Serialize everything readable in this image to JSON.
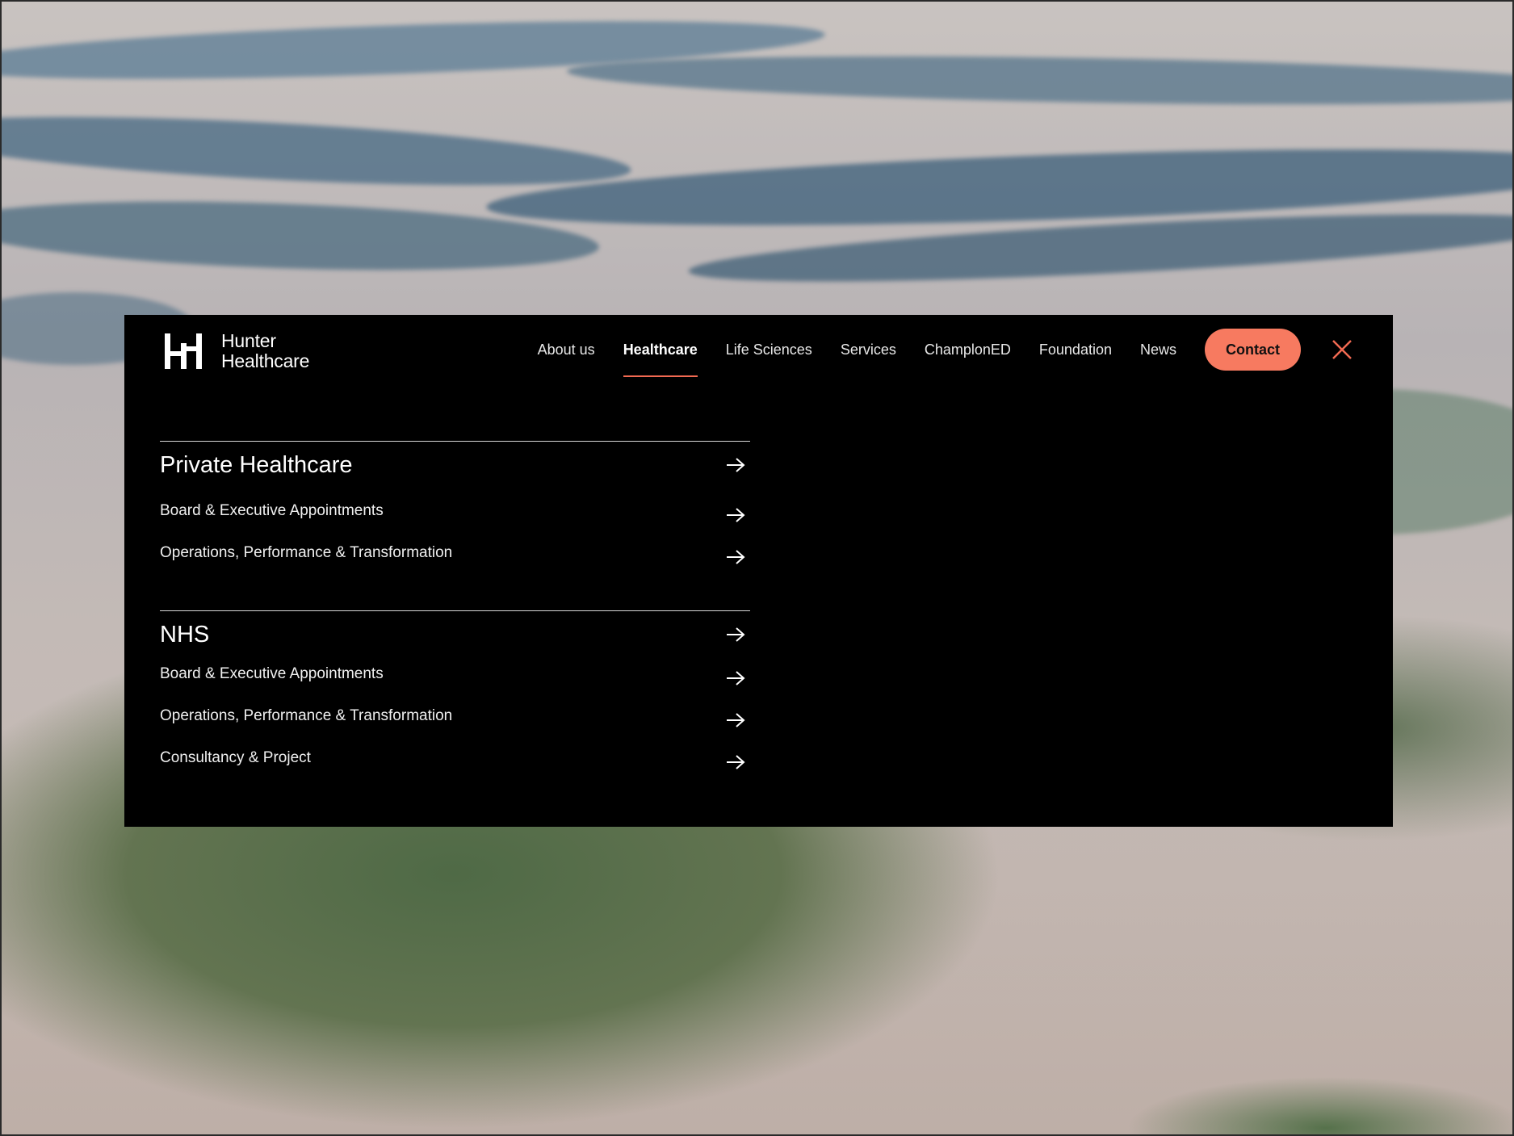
{
  "brand": {
    "name_line1": "Hunter",
    "name_line2": "Healthcare"
  },
  "nav": {
    "items": [
      {
        "label": "About us",
        "active": false
      },
      {
        "label": "Healthcare",
        "active": true
      },
      {
        "label": "Life Sciences",
        "active": false
      },
      {
        "label": "Services",
        "active": false
      },
      {
        "label": "ChamplonED",
        "active": false
      },
      {
        "label": "Foundation",
        "active": false
      },
      {
        "label": "News",
        "active": false
      }
    ],
    "contact_label": "Contact",
    "close_icon": "close-icon"
  },
  "sections": [
    {
      "title": "Private Healthcare",
      "items": [
        "Board & Executive Appointments",
        "Operations, Performance & Transformation"
      ]
    },
    {
      "title": "NHS",
      "items": [
        "Board & Executive Appointments",
        "Operations, Performance & Transformation",
        "Consultancy & Project"
      ]
    }
  ],
  "colors": {
    "accent": "#f77a60",
    "panel": "#000000",
    "underline": "#f26a52"
  }
}
